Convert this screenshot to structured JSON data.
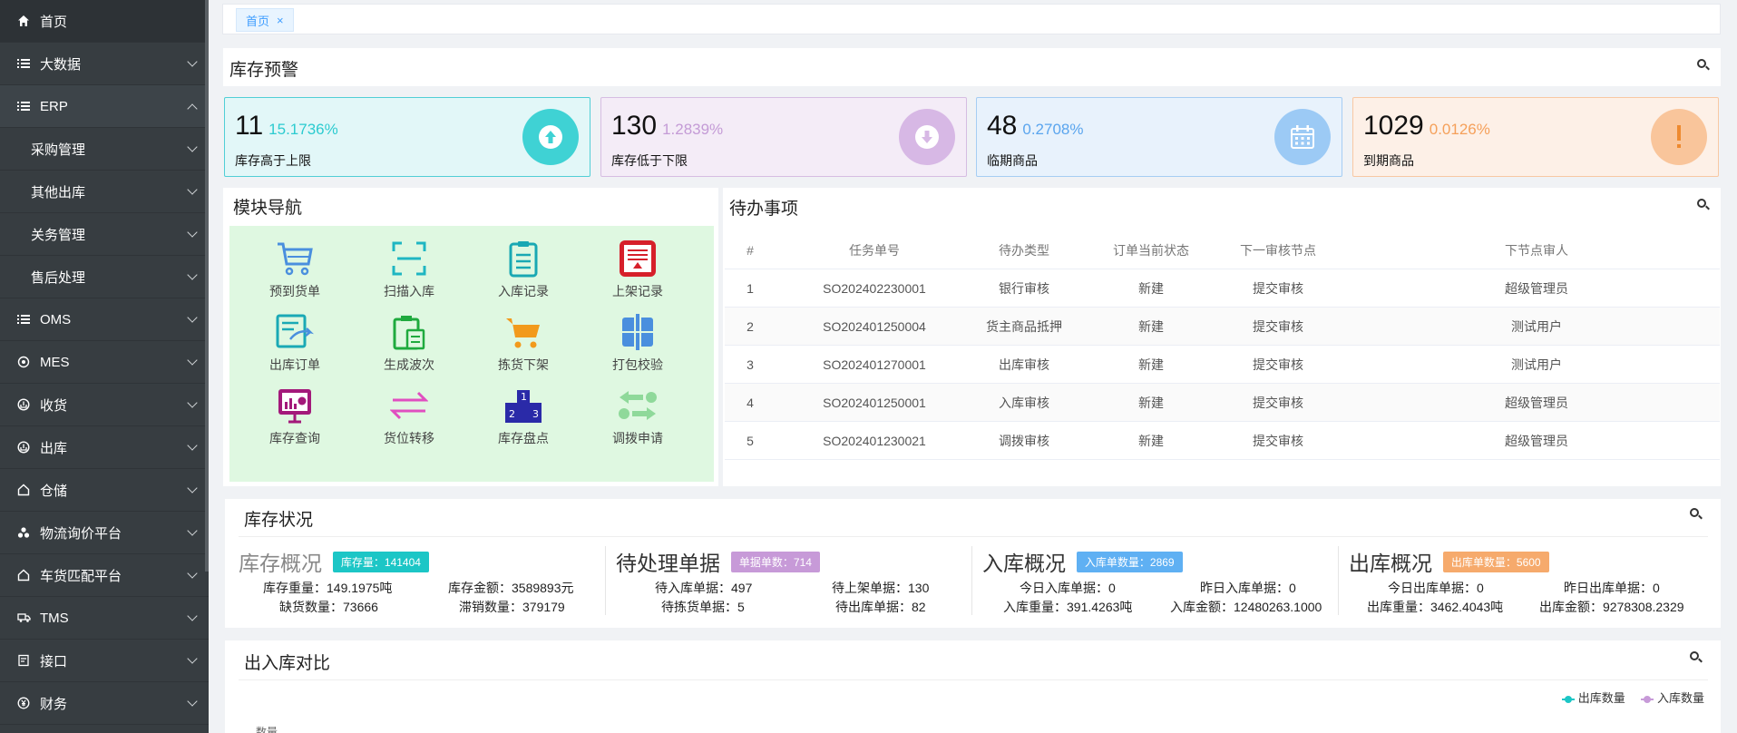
{
  "sidebar": {
    "items": [
      {
        "label": "首页",
        "icon": "home-icon"
      },
      {
        "label": "大数据",
        "icon": "list-icon"
      },
      {
        "label": "ERP",
        "icon": "list-icon"
      },
      {
        "label": "采购管理"
      },
      {
        "label": "其他出库"
      },
      {
        "label": "关务管理"
      },
      {
        "label": "售后处理"
      },
      {
        "label": "OMS",
        "icon": "list-icon"
      },
      {
        "label": "MES",
        "icon": "target-icon"
      },
      {
        "label": "收货",
        "icon": "inbox-icon"
      },
      {
        "label": "出库",
        "icon": "inbox-icon"
      },
      {
        "label": "仓储",
        "icon": "warehouse-icon"
      },
      {
        "label": "物流询价平台",
        "icon": "nodes-icon"
      },
      {
        "label": "车货匹配平台",
        "icon": "warehouse-icon"
      },
      {
        "label": "TMS",
        "icon": "truck-icon"
      },
      {
        "label": "接口",
        "icon": "interface-icon"
      },
      {
        "label": "财务",
        "icon": "yen-icon"
      }
    ]
  },
  "tabs": [
    {
      "label": "首页",
      "close": "×"
    }
  ],
  "alerts": {
    "title": "库存预警",
    "cards": [
      {
        "num": "11",
        "pct": "15.1736%",
        "label": "库存高于上限",
        "color": "#2ccbd0",
        "bg": "#e2f7f8",
        "border": "#51cfd6",
        "icon": "arrow-up-circle-icon"
      },
      {
        "num": "130",
        "pct": "1.2839%",
        "label": "库存低于下限",
        "color": "#c4a0d6",
        "bg": "#f4ecf7",
        "border": "#d6bde2",
        "icon": "arrow-down-circle-icon"
      },
      {
        "num": "48",
        "pct": "0.2708%",
        "label": "临期商品",
        "color": "#5aa5ee",
        "bg": "#e8f2fc",
        "border": "#a6cdf3",
        "icon": "calendar-icon"
      },
      {
        "num": "1029",
        "pct": "0.0126%",
        "label": "到期商品",
        "color": "#f5a05a",
        "bg": "#fdf0e7",
        "border": "#f8c8a3",
        "icon": "exclamation-icon"
      }
    ]
  },
  "modules": {
    "title": "模块导航",
    "items": [
      {
        "label": "预到货单",
        "icon": "cart-icon"
      },
      {
        "label": "扫描入库",
        "icon": "scan-icon"
      },
      {
        "label": "入库记录",
        "icon": "clipboard-icon"
      },
      {
        "label": "上架记录",
        "icon": "shelf-record-icon"
      },
      {
        "label": "出库订单",
        "icon": "outbound-order-icon"
      },
      {
        "label": "生成波次",
        "icon": "wave-icon"
      },
      {
        "label": "拣货下架",
        "icon": "picking-cart-icon"
      },
      {
        "label": "打包校验",
        "icon": "package-check-icon"
      },
      {
        "label": "库存查询",
        "icon": "monitor-chart-icon"
      },
      {
        "label": "货位转移",
        "icon": "transfer-icon"
      },
      {
        "label": "库存盘点",
        "icon": "podium-icon"
      },
      {
        "label": "调拨申请",
        "icon": "exchange-icon"
      }
    ]
  },
  "todo": {
    "title": "待办事项",
    "headers": [
      "#",
      "任务单号",
      "待办类型",
      "订单当前状态",
      "下一审核节点",
      "下节点审人"
    ],
    "rows": [
      [
        "1",
        "SO202402230001",
        "银行审核",
        "新建",
        "提交审核",
        "超级管理员"
      ],
      [
        "2",
        "SO202401250004",
        "货主商品抵押",
        "新建",
        "提交审核",
        "测试用户"
      ],
      [
        "3",
        "SO202401270001",
        "出库审核",
        "新建",
        "提交审核",
        "测试用户"
      ],
      [
        "4",
        "SO202401250001",
        "入库审核",
        "新建",
        "提交审核",
        "超级管理员"
      ],
      [
        "5",
        "SO202401230021",
        "调拨审核",
        "新建",
        "提交审核",
        "超级管理员"
      ]
    ]
  },
  "stock": {
    "title": "库存状况",
    "blocks": [
      {
        "title": "库存概况",
        "badge": "库存量：141404",
        "badge_color": "#1cc6c6",
        "lines": [
          "库存重量：149.1975吨",
          "库存金额：3589893元",
          "缺货数量：73666",
          "滞销数量：379179"
        ]
      },
      {
        "title": "待处理单据",
        "badge": "单据单数：714",
        "badge_color": "#c79ad8",
        "lines": [
          "待入库单据：497",
          "待上架单据：130",
          "待拣货单据：5",
          "待出库单据：82"
        ]
      },
      {
        "title": "入库概况",
        "badge": "入库单数量：2869",
        "badge_color": "#5fb0f3",
        "lines": [
          "今日入库单据：0",
          "昨日入库单据：0",
          "入库重量：391.4263吨",
          "入库金额：12480263.1000"
        ]
      },
      {
        "title": "出库概况",
        "badge": "出库单数量：5600",
        "badge_color": "#f6aa6c",
        "lines": [
          "今日出库单据：0",
          "昨日出库单据：0",
          "出库重量：3462.4043吨",
          "出库金额：9278308.2329"
        ]
      }
    ]
  },
  "compare": {
    "title": "出入库对比",
    "legend": [
      {
        "label": "出库数量",
        "color": "#1cc6c6"
      },
      {
        "label": "入库数量",
        "color": "#c79ad8"
      }
    ],
    "ylabel": "数量"
  }
}
